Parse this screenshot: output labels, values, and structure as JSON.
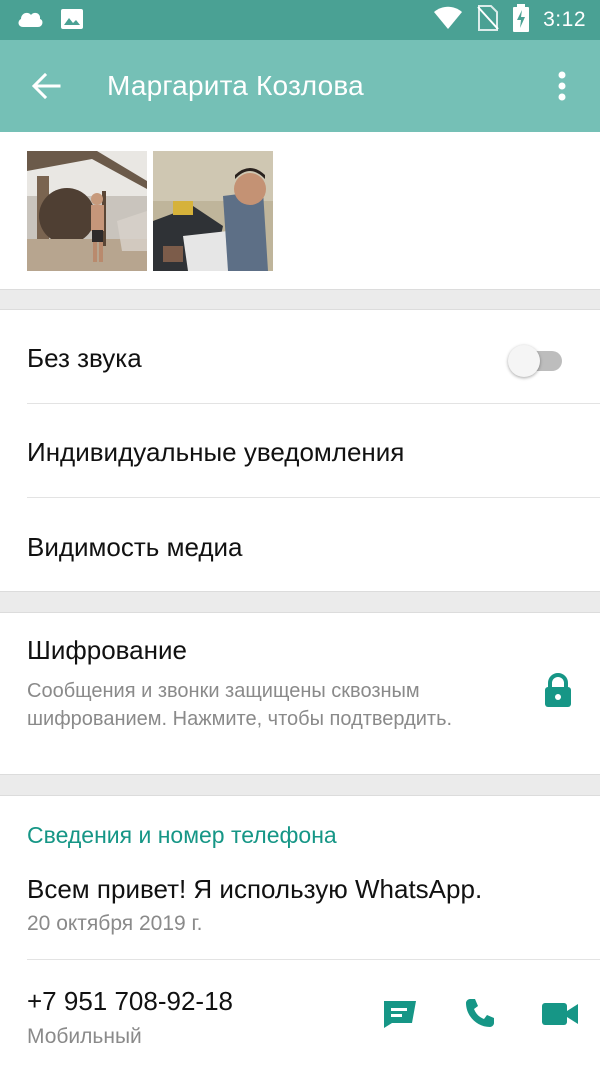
{
  "status_bar": {
    "time": "3:12",
    "left_icons": [
      "cloud-icon",
      "image-icon"
    ],
    "right_icons": [
      "wifi-icon",
      "no-sim-icon",
      "battery-charging-icon"
    ]
  },
  "app_bar": {
    "title": "Маргарита Козлова",
    "back_icon": "arrow-back-icon",
    "menu_icon": "more-vert-icon",
    "color": "#75c0b6"
  },
  "media": {
    "items": [
      "photo-1",
      "photo-2"
    ]
  },
  "settings": {
    "mute_label": "Без звука",
    "mute_enabled": false,
    "custom_notifications_label": "Индивидуальные уведомления",
    "media_visibility_label": "Видимость медиа"
  },
  "encryption": {
    "title": "Шифрование",
    "description": "Сообщения и звонки защищены сквозным шифрованием. Нажмите, чтобы подтвердить.",
    "icon": "lock-icon"
  },
  "about": {
    "section_title": "Сведения и номер телефона",
    "status_text": "Всем привет! Я использую WhatsApp.",
    "status_date": "20 октября 2019 г.",
    "phone": "+7 951 708-92-18",
    "phone_type": "Мобильный",
    "actions": [
      "message-icon",
      "call-icon",
      "video-call-icon"
    ]
  },
  "colors": {
    "accent": "#169686",
    "status_bar": "#4aa194"
  }
}
